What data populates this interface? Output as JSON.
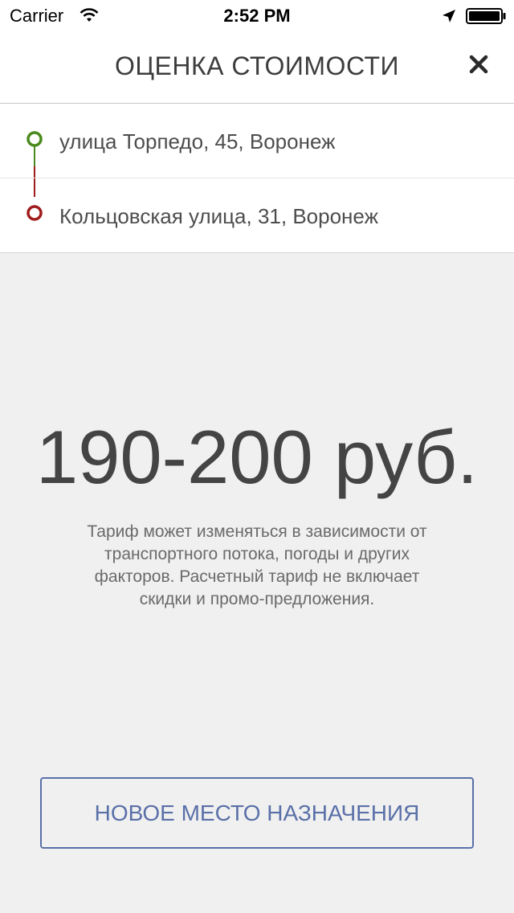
{
  "status_bar": {
    "carrier": "Carrier",
    "time": "2:52 PM",
    "wifi_icon": "wifi-icon",
    "location_icon": "location-arrow-icon",
    "battery_icon": "battery-icon"
  },
  "header": {
    "title": "ОЦЕНКА СТОИМОСТИ",
    "close_icon": "close-icon"
  },
  "route": {
    "from": "улица Торпедо, 45, Воронеж",
    "to": "Кольцовская улица, 31, Воронеж",
    "from_color": "#4a8a1c",
    "to_color": "#a01c1c"
  },
  "estimate": {
    "price": "190-200 руб.",
    "disclaimer": "Тариф может изменяться в зависимости от транспортного потока, погоды и других факторов. Расчетный тариф не включает скидки и промо-предложения."
  },
  "actions": {
    "new_destination": "НОВОЕ МЕСТО НАЗНАЧЕНИЯ"
  },
  "colors": {
    "accent": "#5a70a8",
    "background": "#f0f0f0"
  }
}
